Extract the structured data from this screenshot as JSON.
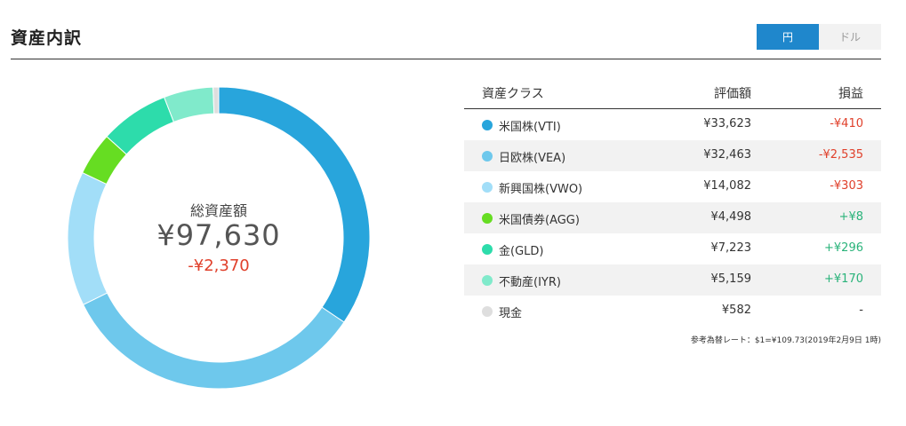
{
  "header": {
    "title": "資産内訳",
    "toggle": {
      "yen_label": "円",
      "dollar_label": "ドル",
      "active": "yen"
    }
  },
  "summary": {
    "label": "総資産額",
    "total": "¥97,630",
    "change": "-¥2,370"
  },
  "table": {
    "headers": {
      "asset_class": "資産クラス",
      "value": "評価額",
      "pl": "損益"
    },
    "rows": [
      {
        "name": "米国株(VTI)",
        "value": "¥33,623",
        "pl": "-¥410",
        "sign": "neg",
        "color": "#28a5dc"
      },
      {
        "name": "日欧株(VEA)",
        "value": "¥32,463",
        "pl": "-¥2,535",
        "sign": "neg",
        "color": "#6ec8ec"
      },
      {
        "name": "新興国株(VWO)",
        "value": "¥14,082",
        "pl": "-¥303",
        "sign": "neg",
        "color": "#a2def8"
      },
      {
        "name": "米国債券(AGG)",
        "value": "¥4,498",
        "pl": "+¥8",
        "sign": "pos",
        "color": "#66dd22"
      },
      {
        "name": "金(GLD)",
        "value": "¥7,223",
        "pl": "+¥296",
        "sign": "pos",
        "color": "#2ddcab"
      },
      {
        "name": "不動産(IYR)",
        "value": "¥5,159",
        "pl": "+¥170",
        "sign": "pos",
        "color": "#80eacb"
      },
      {
        "name": "現金",
        "value": "¥582",
        "pl": "-",
        "sign": "neu",
        "color": "#dedede"
      }
    ],
    "note": "参考為替レート：$1=¥109.73(2019年2月9日 1時)"
  },
  "chart_data": {
    "type": "pie",
    "categories": [
      "米国株(VTI)",
      "日欧株(VEA)",
      "新興国株(VWO)",
      "米国債券(AGG)",
      "金(GLD)",
      "不動産(IYR)",
      "現金"
    ],
    "values": [
      33623,
      32463,
      14082,
      4498,
      7223,
      5159,
      582
    ],
    "colors": [
      "#28a5dc",
      "#6ec8ec",
      "#a2def8",
      "#66dd22",
      "#2ddcab",
      "#80eacb",
      "#dedede"
    ]
  }
}
